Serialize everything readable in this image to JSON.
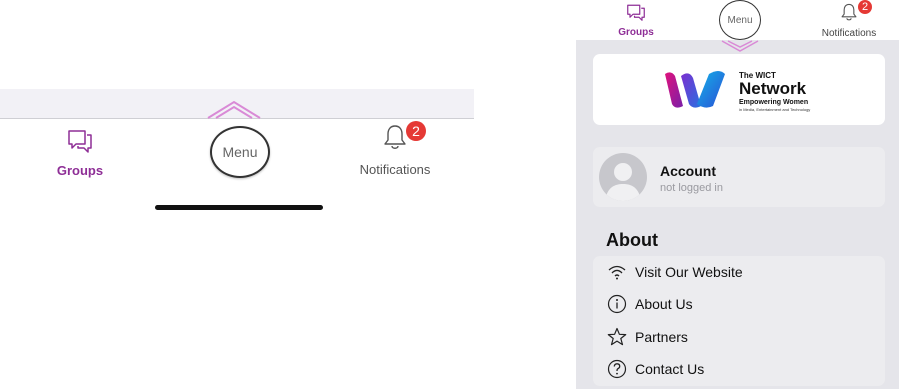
{
  "left": {
    "tabs": {
      "groups_label": "Groups",
      "menu_label": "Menu",
      "notifications_label": "Notifications",
      "notifications_count": "2"
    }
  },
  "right": {
    "tabs": {
      "groups_label": "Groups",
      "menu_label": "Menu",
      "notifications_label": "Notifications",
      "notifications_count": "2"
    },
    "logo": {
      "line1": "The WICT",
      "line2": "Network",
      "line3": "Empowering Women",
      "line4": "in Media, Entertainment and Technology"
    },
    "account": {
      "title": "Account",
      "status": "not logged in"
    },
    "about": {
      "heading": "About",
      "items": [
        {
          "label": "Visit Our Website",
          "icon": "wifi-icon"
        },
        {
          "label": "About Us",
          "icon": "info-icon"
        },
        {
          "label": "Partners",
          "icon": "star-icon"
        },
        {
          "label": "Contact Us",
          "icon": "question-icon"
        }
      ]
    }
  },
  "colors": {
    "accent": "#8e2e96",
    "badge": "#e53935",
    "panel_bg": "#e5e5ea",
    "card_bg": "#ececef"
  }
}
